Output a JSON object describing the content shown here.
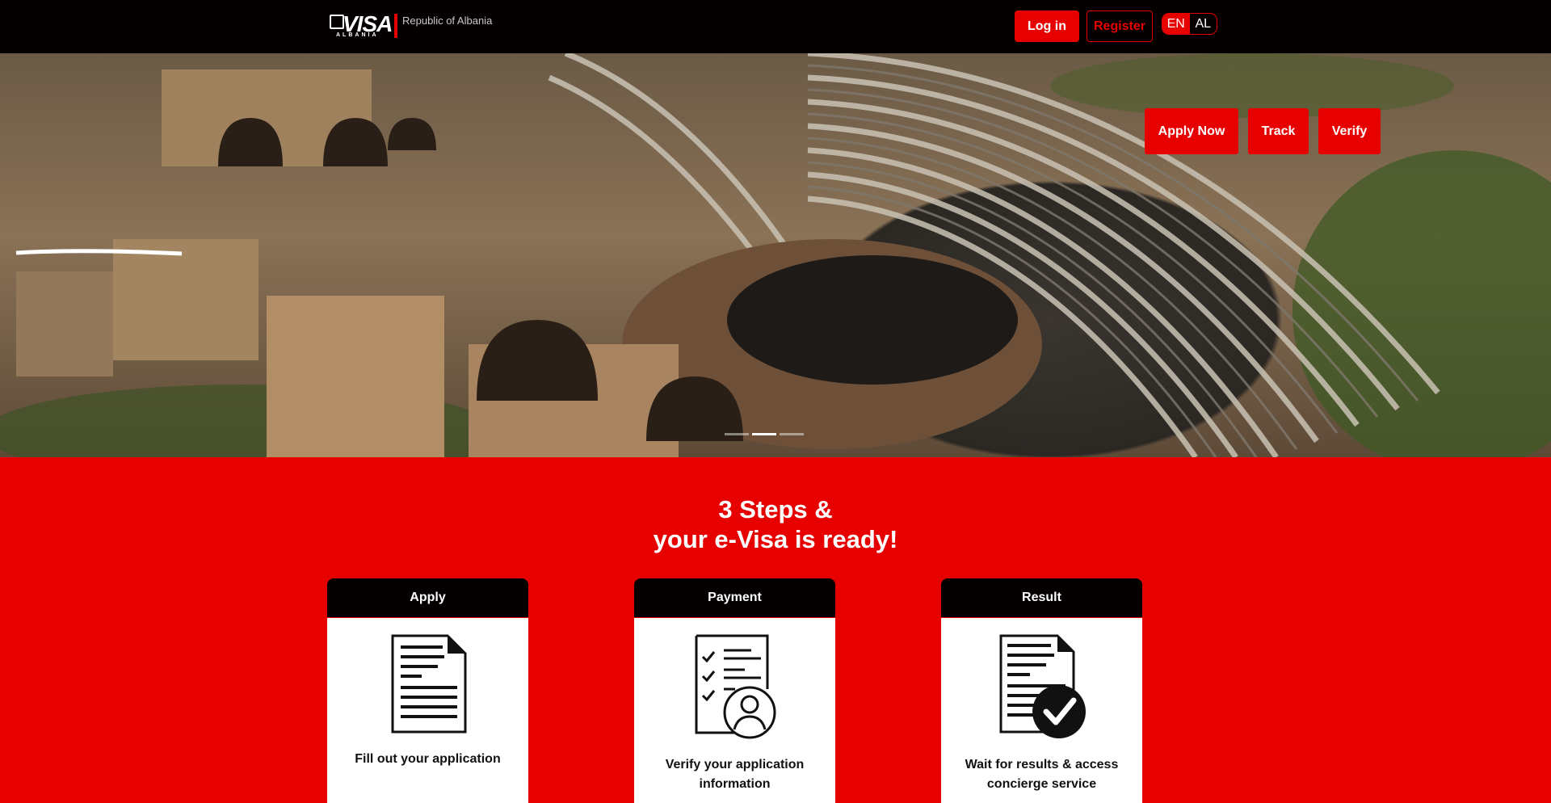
{
  "header": {
    "logo_word": "VISA",
    "logo_sub": "ALBANIA",
    "logo_country": "Republic of Albania",
    "login_label": "Log in",
    "register_label": "Register",
    "lang_en": "EN",
    "lang_al": "AL"
  },
  "hero": {
    "apply_label": "Apply Now",
    "track_label": "Track",
    "verify_label": "Verify",
    "slides": 3,
    "active_slide": 2
  },
  "steps": {
    "title_line1": "3 Steps &",
    "title_line2": "your e-Visa is ready!",
    "cards": [
      {
        "heading": "Apply",
        "icon": "document-icon",
        "text": "Fill out your application"
      },
      {
        "heading": "Payment",
        "icon": "checklist-user-icon",
        "text": "Verify your application information"
      },
      {
        "heading": "Result",
        "icon": "document-check-icon",
        "text": "Wait for results & access concierge service"
      }
    ]
  },
  "colors": {
    "accent": "#e60000",
    "header_bg": "#050000",
    "card_bg": "#ffffff"
  }
}
